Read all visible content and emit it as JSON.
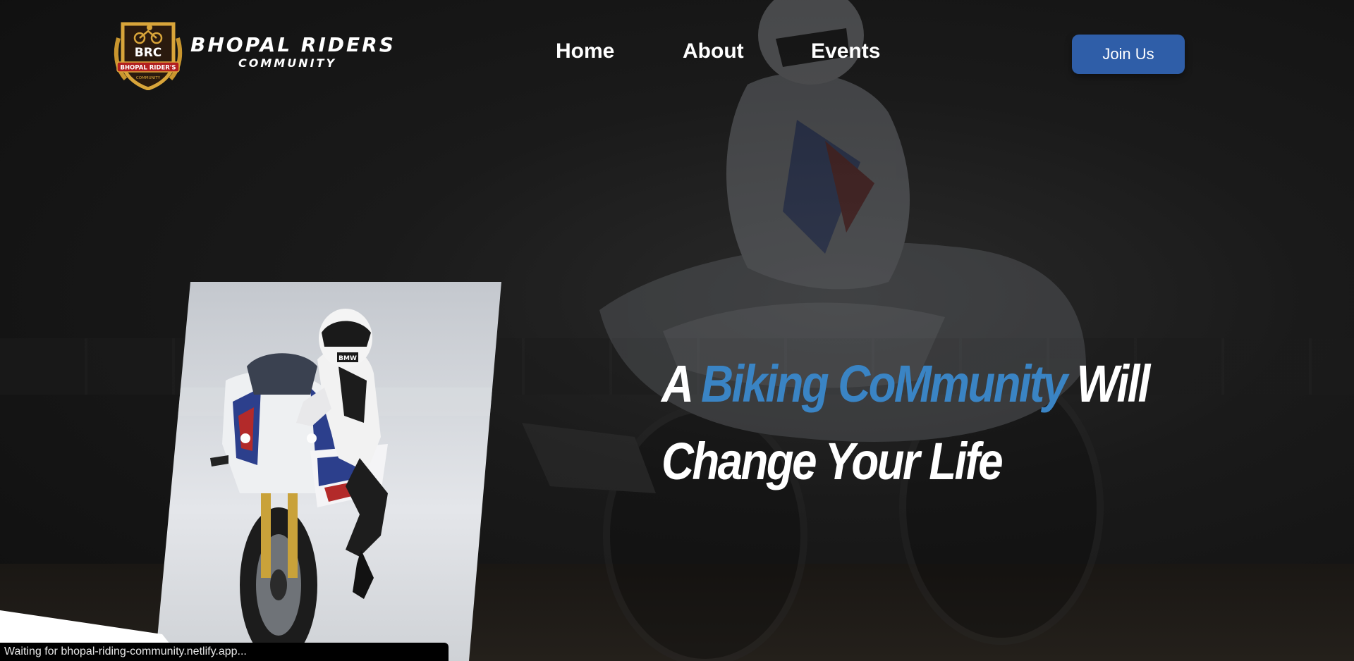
{
  "header": {
    "logo": {
      "badge_text": "BRC",
      "badge_ribbon": "BHOPAL RIDER'S",
      "badge_sub": "COMMUNITY",
      "name_line1": "BHOPAL RIDERS",
      "name_line2": "COMMUNITY"
    },
    "nav": [
      {
        "label": "Home"
      },
      {
        "label": "About"
      },
      {
        "label": "Events"
      }
    ],
    "cta_label": "Join Us"
  },
  "hero": {
    "headline_pre": "A",
    "headline_accent": "Biking CoMmunity",
    "headline_post": "Will Change Your Life",
    "image_alt": "Rider on a BMW superbike",
    "helmet_text": "BMW"
  },
  "status_bar": {
    "text": "Waiting for bhopal-riding-community.netlify.app..."
  },
  "colors": {
    "accent": "#3a84c4",
    "button": "#2f5ea8",
    "background": "#121212",
    "badge_gold": "#c9962e"
  }
}
